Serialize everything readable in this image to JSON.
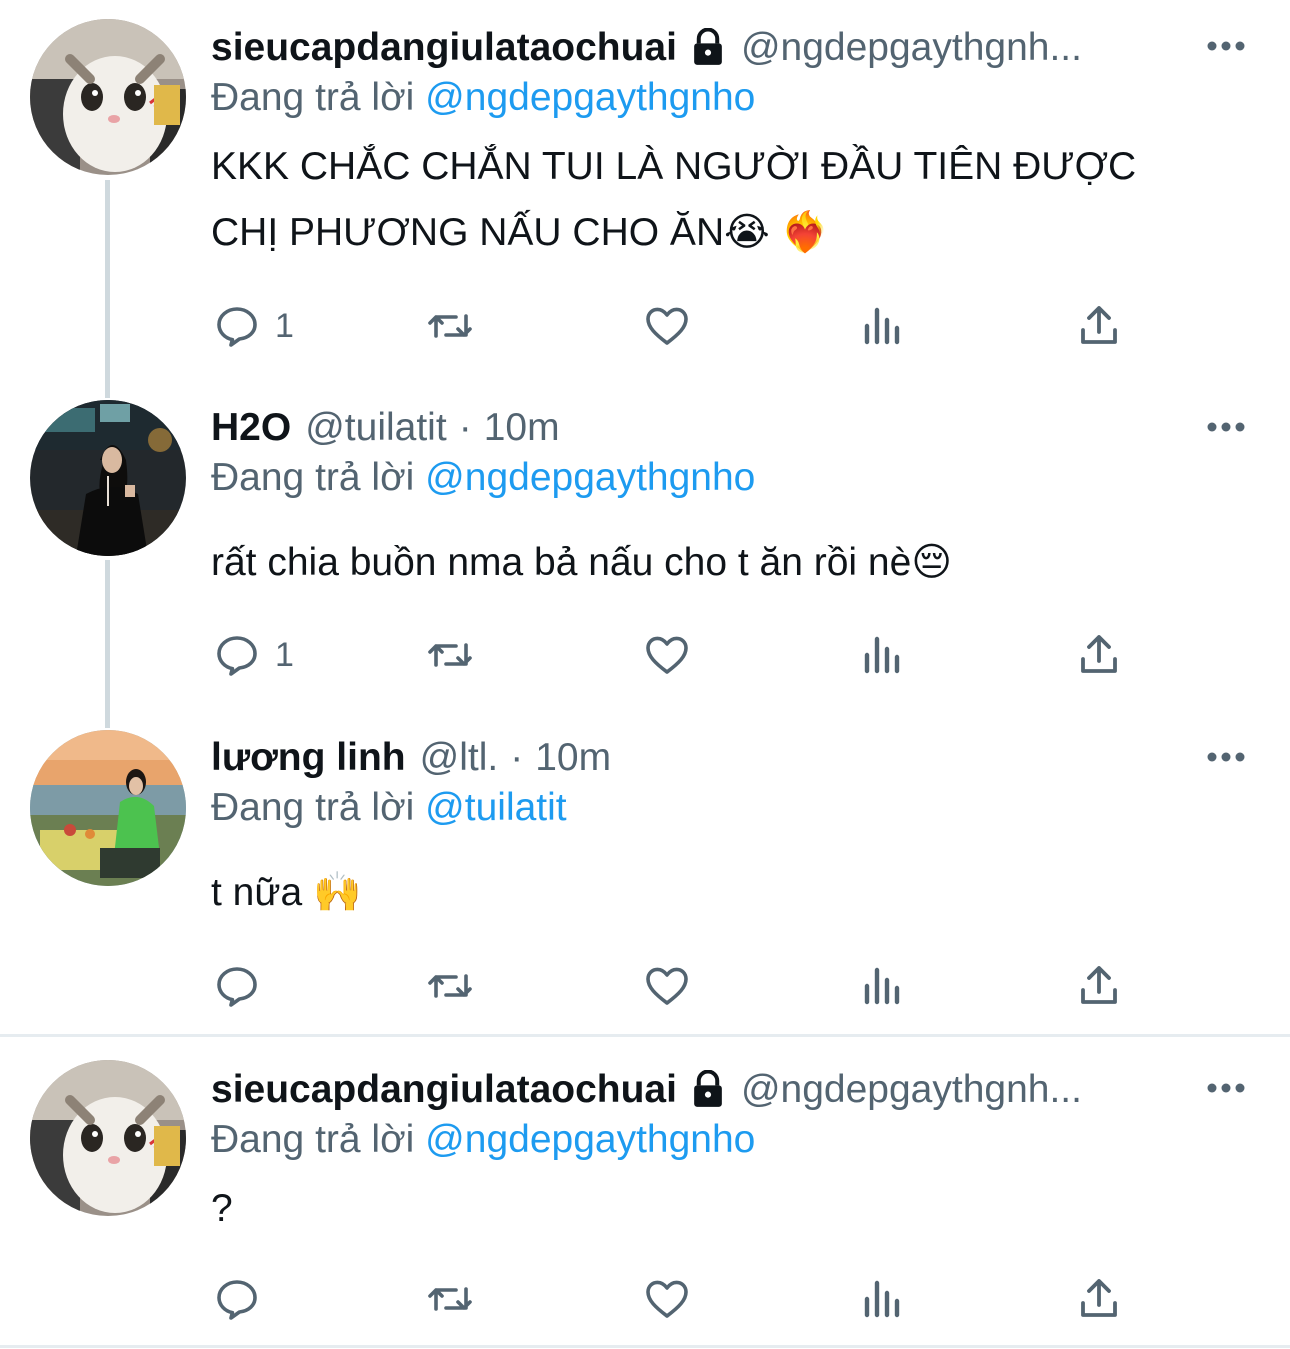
{
  "tweets": [
    {
      "name": "sieucapdangiulataochuai",
      "handle": "@ngdepgaythgnh...",
      "time": "",
      "replying_prefix": "Đang trả lời",
      "replying_to": "@ngdepgaythgnho",
      "text": "KKK CHẮC CHẮN TUI LÀ NGƯỜI ĐẦU TIÊN ĐƯỢC CHỊ PHƯƠNG NẤU CHO ĂN😭 ❤️‍🔥",
      "reply_count": "1",
      "locked": true,
      "avatar": "cat-avatar"
    },
    {
      "name": "H2O",
      "handle": "@tuilatit",
      "time": "10m",
      "replying_prefix": "Đang trả lời",
      "replying_to": "@ngdepgaythgnho",
      "text": "rất chia buồn nma bả nấu cho t ăn rồi nè😔",
      "reply_count": "1",
      "locked": false,
      "avatar": "girl-night-avatar"
    },
    {
      "name": "lương linh",
      "handle": "@ltl.",
      "time": "10m",
      "replying_prefix": "Đang trả lời",
      "replying_to": "@tuilatit",
      "text": "t nữa 🙌",
      "reply_count": "",
      "locked": false,
      "avatar": "girl-beach-avatar"
    },
    {
      "name": "sieucapdangiulataochuai",
      "handle": "@ngdepgaythgnh...",
      "time": "",
      "replying_prefix": "Đang trả lời",
      "replying_to": "@ngdepgaythgnho",
      "text": "?",
      "reply_count": "",
      "locked": true,
      "avatar": "cat-avatar"
    }
  ],
  "icons": {
    "reply": "reply-icon",
    "retweet": "retweet-icon",
    "like": "like-icon",
    "views": "views-icon",
    "share": "share-icon",
    "more": "more-icon",
    "lock": "lock-icon"
  },
  "colors": {
    "text": "#0f1419",
    "secondary": "#536471",
    "link": "#1d9bf0",
    "thread_line": "#cfd9de",
    "divider": "#e6ecf0"
  }
}
